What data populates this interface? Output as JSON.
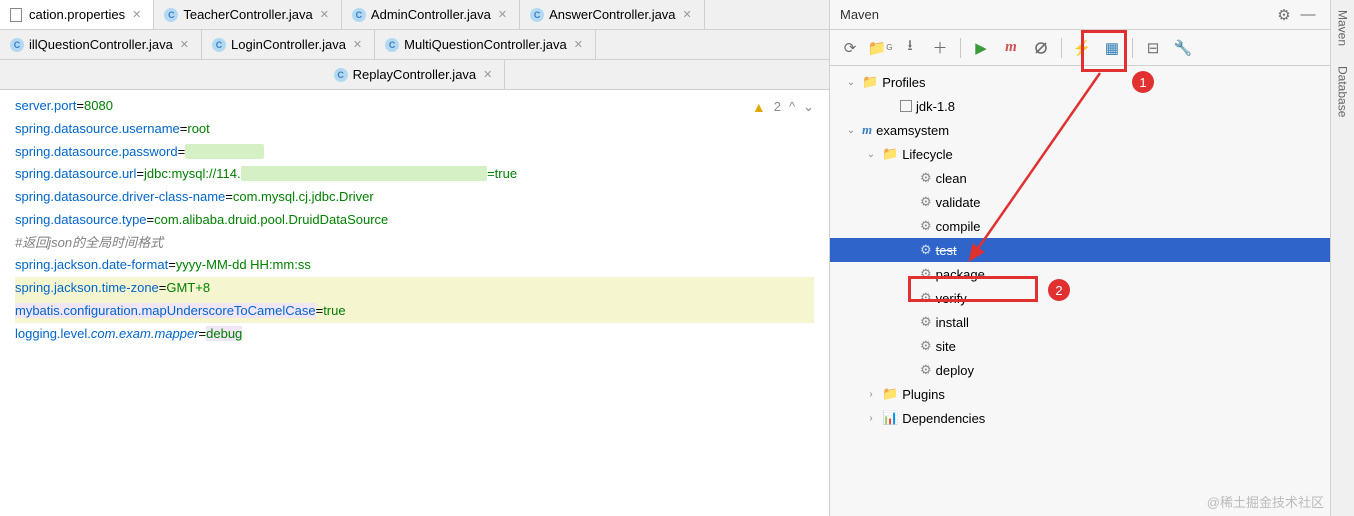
{
  "tabs": {
    "row1": [
      {
        "label": "cation.properties",
        "type": "prop",
        "active": true
      },
      {
        "label": "TeacherController.java",
        "type": "java"
      },
      {
        "label": "AdminController.java",
        "type": "java"
      },
      {
        "label": "AnswerController.java",
        "type": "java"
      }
    ],
    "row2": [
      {
        "label": "illQuestionController.java",
        "type": "java"
      },
      {
        "label": "LoginController.java",
        "type": "java"
      },
      {
        "label": "MultiQuestionController.java",
        "type": "java"
      }
    ],
    "row3": [
      {
        "label": "ReplayController.java",
        "type": "java"
      }
    ]
  },
  "editor": {
    "warn_count": "2",
    "lines": [
      {
        "prop": "server.port",
        "val": "8080"
      },
      {
        "prop": "spring.datasource.username",
        "val": "root"
      },
      {
        "prop": "spring.datasource.password",
        "val": "",
        "blur": true
      },
      {
        "prop": "spring.datasource.url",
        "val": "jdbc:mysql://114.",
        "blur_after": true,
        "tail": "=true"
      },
      {
        "prop": "spring.datasource.driver-class-name",
        "val": "com.mysql.cj.jdbc.Driver"
      },
      {
        "prop": "spring.datasource.type",
        "val": "com.alibaba.druid.pool.DruidDataSource"
      },
      {
        "comment": "#返回json的全局时间格式"
      },
      {
        "prop": "spring.jackson.date-format",
        "val": "yyyy-MM-dd HH:mm:ss"
      },
      {
        "prop": "spring.jackson.time-zone",
        "val": "GMT+8",
        "hl": "y"
      },
      {
        "prop": "mybatis.configuration.mapUnderscoreToCamelCase",
        "val": "true",
        "hl": "y",
        "prop_hl": "p"
      },
      {
        "prop": "logging.level.com.exam.mapper",
        "val": "debug",
        "val_hl": "p",
        "prop_italic_part": "com.exam.mapper"
      }
    ]
  },
  "maven": {
    "title": "Maven",
    "toolbar_icons": [
      "refresh",
      "generate",
      "download",
      "add",
      "run",
      "m-goal",
      "separator",
      "skip-test",
      "lightning",
      "toggle",
      "separator",
      "collapse",
      "wrench"
    ],
    "tree": {
      "profiles": {
        "label": "Profiles",
        "children": [
          {
            "label": "jdk-1.8",
            "checkbox": true
          }
        ]
      },
      "project": {
        "label": "examsystem",
        "lifecycle": {
          "label": "Lifecycle",
          "items": [
            "clean",
            "validate",
            "compile",
            "test",
            "package",
            "verify",
            "install",
            "site",
            "deploy"
          ],
          "selected": "test",
          "highlighted": "package"
        },
        "plugins": "Plugins",
        "dependencies": "Dependencies"
      }
    }
  },
  "side_tabs": [
    "Maven",
    "Database"
  ],
  "annotations": {
    "bubble1": "1",
    "bubble2": "2"
  },
  "watermark": "@稀土掘金技术社区"
}
